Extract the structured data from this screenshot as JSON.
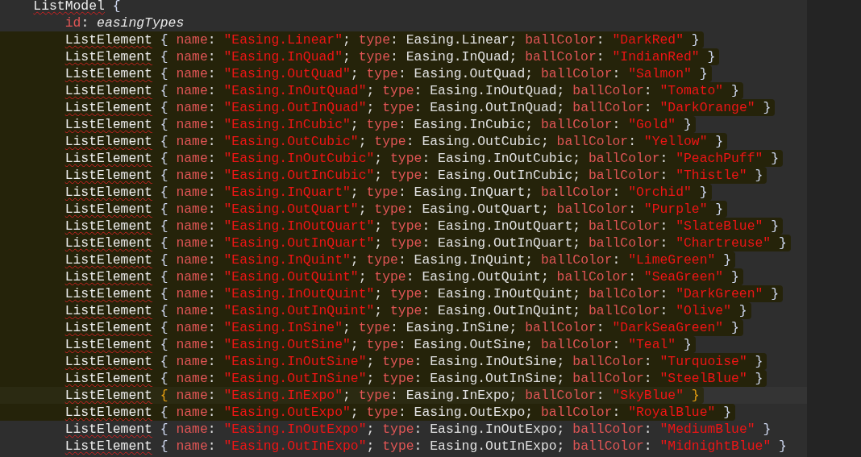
{
  "editor": {
    "lines": [
      {
        "selected": false,
        "current": false,
        "tokens": [
          {
            "kind": "type",
            "text": "ListModel"
          },
          {
            "kind": "brace",
            "text": " {",
            "matched": false
          }
        ],
        "children": [
          {
            "selected": false,
            "current": false,
            "tokens": [
              {
                "kind": "prop",
                "text": "id"
              },
              {
                "kind": "punct",
                "text": ": "
              },
              {
                "kind": "italic",
                "text": "easingTypes"
              }
            ]
          },
          {
            "selected": true,
            "current": false,
            "tokens": [
              {
                "kind": "type",
                "text": "ListElement"
              },
              {
                "kind": "brace",
                "text": " { ",
                "matched": false
              },
              {
                "kind": "prop",
                "text": "name"
              },
              {
                "kind": "punct",
                "text": ": "
              },
              {
                "kind": "str",
                "text": "\"Easing.Linear\""
              },
              {
                "kind": "punct",
                "text": "; "
              },
              {
                "kind": "prop",
                "text": "type"
              },
              {
                "kind": "punct",
                "text": ": Easing.Linear; "
              },
              {
                "kind": "prop",
                "text": "ballColor"
              },
              {
                "kind": "punct",
                "text": ": "
              },
              {
                "kind": "str",
                "text": "\"DarkRed\""
              },
              {
                "kind": "brace",
                "text": " }",
                "matched": false
              }
            ]
          },
          {
            "selected": true,
            "current": false,
            "tokens": [
              {
                "kind": "type",
                "text": "ListElement"
              },
              {
                "kind": "brace",
                "text": " { ",
                "matched": false
              },
              {
                "kind": "prop",
                "text": "name"
              },
              {
                "kind": "punct",
                "text": ": "
              },
              {
                "kind": "str",
                "text": "\"Easing.InQuad\""
              },
              {
                "kind": "punct",
                "text": "; "
              },
              {
                "kind": "prop",
                "text": "type"
              },
              {
                "kind": "punct",
                "text": ": Easing.InQuad; "
              },
              {
                "kind": "prop",
                "text": "ballColor"
              },
              {
                "kind": "punct",
                "text": ": "
              },
              {
                "kind": "str",
                "text": "\"IndianRed\""
              },
              {
                "kind": "brace",
                "text": " }",
                "matched": false
              }
            ]
          },
          {
            "selected": true,
            "current": false,
            "tokens": [
              {
                "kind": "type",
                "text": "ListElement"
              },
              {
                "kind": "brace",
                "text": " { ",
                "matched": false
              },
              {
                "kind": "prop",
                "text": "name"
              },
              {
                "kind": "punct",
                "text": ": "
              },
              {
                "kind": "str",
                "text": "\"Easing.OutQuad\""
              },
              {
                "kind": "punct",
                "text": "; "
              },
              {
                "kind": "prop",
                "text": "type"
              },
              {
                "kind": "punct",
                "text": ": Easing.OutQuad; "
              },
              {
                "kind": "prop",
                "text": "ballColor"
              },
              {
                "kind": "punct",
                "text": ": "
              },
              {
                "kind": "str",
                "text": "\"Salmon\""
              },
              {
                "kind": "brace",
                "text": " }",
                "matched": false
              }
            ]
          },
          {
            "selected": true,
            "current": false,
            "tokens": [
              {
                "kind": "type",
                "text": "ListElement"
              },
              {
                "kind": "brace",
                "text": " { ",
                "matched": false
              },
              {
                "kind": "prop",
                "text": "name"
              },
              {
                "kind": "punct",
                "text": ": "
              },
              {
                "kind": "str",
                "text": "\"Easing.InOutQuad\""
              },
              {
                "kind": "punct",
                "text": "; "
              },
              {
                "kind": "prop",
                "text": "type"
              },
              {
                "kind": "punct",
                "text": ": Easing.InOutQuad; "
              },
              {
                "kind": "prop",
                "text": "ballColor"
              },
              {
                "kind": "punct",
                "text": ": "
              },
              {
                "kind": "str",
                "text": "\"Tomato\""
              },
              {
                "kind": "brace",
                "text": " }",
                "matched": false
              }
            ]
          },
          {
            "selected": true,
            "current": false,
            "tokens": [
              {
                "kind": "type",
                "text": "ListElement"
              },
              {
                "kind": "brace",
                "text": " { ",
                "matched": false
              },
              {
                "kind": "prop",
                "text": "name"
              },
              {
                "kind": "punct",
                "text": ": "
              },
              {
                "kind": "str",
                "text": "\"Easing.OutInQuad\""
              },
              {
                "kind": "punct",
                "text": "; "
              },
              {
                "kind": "prop",
                "text": "type"
              },
              {
                "kind": "punct",
                "text": ": Easing.OutInQuad; "
              },
              {
                "kind": "prop",
                "text": "ballColor"
              },
              {
                "kind": "punct",
                "text": ": "
              },
              {
                "kind": "str",
                "text": "\"DarkOrange\""
              },
              {
                "kind": "brace",
                "text": " }",
                "matched": false
              }
            ]
          },
          {
            "selected": true,
            "current": false,
            "tokens": [
              {
                "kind": "type",
                "text": "ListElement"
              },
              {
                "kind": "brace",
                "text": " { ",
                "matched": false
              },
              {
                "kind": "prop",
                "text": "name"
              },
              {
                "kind": "punct",
                "text": ": "
              },
              {
                "kind": "str",
                "text": "\"Easing.InCubic\""
              },
              {
                "kind": "punct",
                "text": "; "
              },
              {
                "kind": "prop",
                "text": "type"
              },
              {
                "kind": "punct",
                "text": ": Easing.InCubic; "
              },
              {
                "kind": "prop",
                "text": "ballColor"
              },
              {
                "kind": "punct",
                "text": ": "
              },
              {
                "kind": "str",
                "text": "\"Gold\""
              },
              {
                "kind": "brace",
                "text": " }",
                "matched": false
              }
            ]
          },
          {
            "selected": true,
            "current": false,
            "tokens": [
              {
                "kind": "type",
                "text": "ListElement"
              },
              {
                "kind": "brace",
                "text": " { ",
                "matched": false
              },
              {
                "kind": "prop",
                "text": "name"
              },
              {
                "kind": "punct",
                "text": ": "
              },
              {
                "kind": "str",
                "text": "\"Easing.OutCubic\""
              },
              {
                "kind": "punct",
                "text": "; "
              },
              {
                "kind": "prop",
                "text": "type"
              },
              {
                "kind": "punct",
                "text": ": Easing.OutCubic; "
              },
              {
                "kind": "prop",
                "text": "ballColor"
              },
              {
                "kind": "punct",
                "text": ": "
              },
              {
                "kind": "str",
                "text": "\"Yellow\""
              },
              {
                "kind": "brace",
                "text": " }",
                "matched": false
              }
            ]
          },
          {
            "selected": true,
            "current": false,
            "tokens": [
              {
                "kind": "type",
                "text": "ListElement"
              },
              {
                "kind": "brace",
                "text": " { ",
                "matched": false
              },
              {
                "kind": "prop",
                "text": "name"
              },
              {
                "kind": "punct",
                "text": ": "
              },
              {
                "kind": "str",
                "text": "\"Easing.InOutCubic\""
              },
              {
                "kind": "punct",
                "text": "; "
              },
              {
                "kind": "prop",
                "text": "type"
              },
              {
                "kind": "punct",
                "text": ": Easing.InOutCubic; "
              },
              {
                "kind": "prop",
                "text": "ballColor"
              },
              {
                "kind": "punct",
                "text": ": "
              },
              {
                "kind": "str",
                "text": "\"PeachPuff\""
              },
              {
                "kind": "brace",
                "text": " }",
                "matched": false
              }
            ]
          },
          {
            "selected": true,
            "current": false,
            "tokens": [
              {
                "kind": "type",
                "text": "ListElement"
              },
              {
                "kind": "brace",
                "text": " { ",
                "matched": false
              },
              {
                "kind": "prop",
                "text": "name"
              },
              {
                "kind": "punct",
                "text": ": "
              },
              {
                "kind": "str",
                "text": "\"Easing.OutInCubic\""
              },
              {
                "kind": "punct",
                "text": "; "
              },
              {
                "kind": "prop",
                "text": "type"
              },
              {
                "kind": "punct",
                "text": ": Easing.OutInCubic; "
              },
              {
                "kind": "prop",
                "text": "ballColor"
              },
              {
                "kind": "punct",
                "text": ": "
              },
              {
                "kind": "str",
                "text": "\"Thistle\""
              },
              {
                "kind": "brace",
                "text": " }",
                "matched": false
              }
            ]
          },
          {
            "selected": true,
            "current": false,
            "tokens": [
              {
                "kind": "type",
                "text": "ListElement"
              },
              {
                "kind": "brace",
                "text": " { ",
                "matched": false
              },
              {
                "kind": "prop",
                "text": "name"
              },
              {
                "kind": "punct",
                "text": ": "
              },
              {
                "kind": "str",
                "text": "\"Easing.InQuart\""
              },
              {
                "kind": "punct",
                "text": "; "
              },
              {
                "kind": "prop",
                "text": "type"
              },
              {
                "kind": "punct",
                "text": ": Easing.InQuart; "
              },
              {
                "kind": "prop",
                "text": "ballColor"
              },
              {
                "kind": "punct",
                "text": ": "
              },
              {
                "kind": "str",
                "text": "\"Orchid\""
              },
              {
                "kind": "brace",
                "text": " }",
                "matched": false
              }
            ]
          },
          {
            "selected": true,
            "current": false,
            "tokens": [
              {
                "kind": "type",
                "text": "ListElement"
              },
              {
                "kind": "brace",
                "text": " { ",
                "matched": false
              },
              {
                "kind": "prop",
                "text": "name"
              },
              {
                "kind": "punct",
                "text": ": "
              },
              {
                "kind": "str",
                "text": "\"Easing.OutQuart\""
              },
              {
                "kind": "punct",
                "text": "; "
              },
              {
                "kind": "prop",
                "text": "type"
              },
              {
                "kind": "punct",
                "text": ": Easing.OutQuart; "
              },
              {
                "kind": "prop",
                "text": "ballColor"
              },
              {
                "kind": "punct",
                "text": ": "
              },
              {
                "kind": "str",
                "text": "\"Purple\""
              },
              {
                "kind": "brace",
                "text": " }",
                "matched": false
              }
            ]
          },
          {
            "selected": true,
            "current": false,
            "tokens": [
              {
                "kind": "type",
                "text": "ListElement"
              },
              {
                "kind": "brace",
                "text": " { ",
                "matched": false
              },
              {
                "kind": "prop",
                "text": "name"
              },
              {
                "kind": "punct",
                "text": ": "
              },
              {
                "kind": "str",
                "text": "\"Easing.InOutQuart\""
              },
              {
                "kind": "punct",
                "text": "; "
              },
              {
                "kind": "prop",
                "text": "type"
              },
              {
                "kind": "punct",
                "text": ": Easing.InOutQuart; "
              },
              {
                "kind": "prop",
                "text": "ballColor"
              },
              {
                "kind": "punct",
                "text": ": "
              },
              {
                "kind": "str",
                "text": "\"SlateBlue\""
              },
              {
                "kind": "brace",
                "text": " }",
                "matched": false
              }
            ]
          },
          {
            "selected": true,
            "current": false,
            "tokens": [
              {
                "kind": "type",
                "text": "ListElement"
              },
              {
                "kind": "brace",
                "text": " { ",
                "matched": false
              },
              {
                "kind": "prop",
                "text": "name"
              },
              {
                "kind": "punct",
                "text": ": "
              },
              {
                "kind": "str",
                "text": "\"Easing.OutInQuart\""
              },
              {
                "kind": "punct",
                "text": "; "
              },
              {
                "kind": "prop",
                "text": "type"
              },
              {
                "kind": "punct",
                "text": ": Easing.OutInQuart; "
              },
              {
                "kind": "prop",
                "text": "ballColor"
              },
              {
                "kind": "punct",
                "text": ": "
              },
              {
                "kind": "str",
                "text": "\"Chartreuse\""
              },
              {
                "kind": "brace",
                "text": " }",
                "matched": false
              }
            ]
          },
          {
            "selected": true,
            "current": false,
            "tokens": [
              {
                "kind": "type",
                "text": "ListElement"
              },
              {
                "kind": "brace",
                "text": " { ",
                "matched": false
              },
              {
                "kind": "prop",
                "text": "name"
              },
              {
                "kind": "punct",
                "text": ": "
              },
              {
                "kind": "str",
                "text": "\"Easing.InQuint\""
              },
              {
                "kind": "punct",
                "text": "; "
              },
              {
                "kind": "prop",
                "text": "type"
              },
              {
                "kind": "punct",
                "text": ": Easing.InQuint; "
              },
              {
                "kind": "prop",
                "text": "ballColor"
              },
              {
                "kind": "punct",
                "text": ": "
              },
              {
                "kind": "str",
                "text": "\"LimeGreen\""
              },
              {
                "kind": "brace",
                "text": " }",
                "matched": false
              }
            ]
          },
          {
            "selected": true,
            "current": false,
            "tokens": [
              {
                "kind": "type",
                "text": "ListElement"
              },
              {
                "kind": "brace",
                "text": " { ",
                "matched": false
              },
              {
                "kind": "prop",
                "text": "name"
              },
              {
                "kind": "punct",
                "text": ": "
              },
              {
                "kind": "str",
                "text": "\"Easing.OutQuint\""
              },
              {
                "kind": "punct",
                "text": "; "
              },
              {
                "kind": "prop",
                "text": "type"
              },
              {
                "kind": "punct",
                "text": ": Easing.OutQuint; "
              },
              {
                "kind": "prop",
                "text": "ballColor"
              },
              {
                "kind": "punct",
                "text": ": "
              },
              {
                "kind": "str",
                "text": "\"SeaGreen\""
              },
              {
                "kind": "brace",
                "text": " }",
                "matched": false
              }
            ]
          },
          {
            "selected": true,
            "current": false,
            "tokens": [
              {
                "kind": "type",
                "text": "ListElement"
              },
              {
                "kind": "brace",
                "text": " { ",
                "matched": false
              },
              {
                "kind": "prop",
                "text": "name"
              },
              {
                "kind": "punct",
                "text": ": "
              },
              {
                "kind": "str",
                "text": "\"Easing.InOutQuint\""
              },
              {
                "kind": "punct",
                "text": "; "
              },
              {
                "kind": "prop",
                "text": "type"
              },
              {
                "kind": "punct",
                "text": ": Easing.InOutQuint; "
              },
              {
                "kind": "prop",
                "text": "ballColor"
              },
              {
                "kind": "punct",
                "text": ": "
              },
              {
                "kind": "str",
                "text": "\"DarkGreen\""
              },
              {
                "kind": "brace",
                "text": " }",
                "matched": false
              }
            ]
          },
          {
            "selected": true,
            "current": false,
            "tokens": [
              {
                "kind": "type",
                "text": "ListElement"
              },
              {
                "kind": "brace",
                "text": " { ",
                "matched": false
              },
              {
                "kind": "prop",
                "text": "name"
              },
              {
                "kind": "punct",
                "text": ": "
              },
              {
                "kind": "str",
                "text": "\"Easing.OutInQuint\""
              },
              {
                "kind": "punct",
                "text": "; "
              },
              {
                "kind": "prop",
                "text": "type"
              },
              {
                "kind": "punct",
                "text": ": Easing.OutInQuint; "
              },
              {
                "kind": "prop",
                "text": "ballColor"
              },
              {
                "kind": "punct",
                "text": ": "
              },
              {
                "kind": "str",
                "text": "\"Olive\""
              },
              {
                "kind": "brace",
                "text": " }",
                "matched": false
              }
            ]
          },
          {
            "selected": true,
            "current": false,
            "tokens": [
              {
                "kind": "type",
                "text": "ListElement"
              },
              {
                "kind": "brace",
                "text": " { ",
                "matched": false
              },
              {
                "kind": "prop",
                "text": "name"
              },
              {
                "kind": "punct",
                "text": ": "
              },
              {
                "kind": "str",
                "text": "\"Easing.InSine\""
              },
              {
                "kind": "punct",
                "text": "; "
              },
              {
                "kind": "prop",
                "text": "type"
              },
              {
                "kind": "punct",
                "text": ": Easing.InSine; "
              },
              {
                "kind": "prop",
                "text": "ballColor"
              },
              {
                "kind": "punct",
                "text": ": "
              },
              {
                "kind": "str",
                "text": "\"DarkSeaGreen\""
              },
              {
                "kind": "brace",
                "text": " }",
                "matched": false
              }
            ]
          },
          {
            "selected": true,
            "current": false,
            "tokens": [
              {
                "kind": "type",
                "text": "ListElement"
              },
              {
                "kind": "brace",
                "text": " { ",
                "matched": false
              },
              {
                "kind": "prop",
                "text": "name"
              },
              {
                "kind": "punct",
                "text": ": "
              },
              {
                "kind": "str",
                "text": "\"Easing.OutSine\""
              },
              {
                "kind": "punct",
                "text": "; "
              },
              {
                "kind": "prop",
                "text": "type"
              },
              {
                "kind": "punct",
                "text": ": Easing.OutSine; "
              },
              {
                "kind": "prop",
                "text": "ballColor"
              },
              {
                "kind": "punct",
                "text": ": "
              },
              {
                "kind": "str",
                "text": "\"Teal\""
              },
              {
                "kind": "brace",
                "text": " }",
                "matched": false
              }
            ]
          },
          {
            "selected": true,
            "current": false,
            "tokens": [
              {
                "kind": "type",
                "text": "ListElement"
              },
              {
                "kind": "brace",
                "text": " { ",
                "matched": false
              },
              {
                "kind": "prop",
                "text": "name"
              },
              {
                "kind": "punct",
                "text": ": "
              },
              {
                "kind": "str",
                "text": "\"Easing.InOutSine\""
              },
              {
                "kind": "punct",
                "text": "; "
              },
              {
                "kind": "prop",
                "text": "type"
              },
              {
                "kind": "punct",
                "text": ": Easing.InOutSine; "
              },
              {
                "kind": "prop",
                "text": "ballColor"
              },
              {
                "kind": "punct",
                "text": ": "
              },
              {
                "kind": "str",
                "text": "\"Turquoise\""
              },
              {
                "kind": "brace",
                "text": " }",
                "matched": false
              }
            ]
          },
          {
            "selected": true,
            "current": false,
            "tokens": [
              {
                "kind": "type",
                "text": "ListElement"
              },
              {
                "kind": "brace",
                "text": " { ",
                "matched": false
              },
              {
                "kind": "prop",
                "text": "name"
              },
              {
                "kind": "punct",
                "text": ": "
              },
              {
                "kind": "str",
                "text": "\"Easing.OutInSine\""
              },
              {
                "kind": "punct",
                "text": "; "
              },
              {
                "kind": "prop",
                "text": "type"
              },
              {
                "kind": "punct",
                "text": ": Easing.OutInSine; "
              },
              {
                "kind": "prop",
                "text": "ballColor"
              },
              {
                "kind": "punct",
                "text": ": "
              },
              {
                "kind": "str",
                "text": "\"SteelBlue\""
              },
              {
                "kind": "brace",
                "text": " }",
                "matched": false
              }
            ]
          },
          {
            "selected": true,
            "current": true,
            "tokens": [
              {
                "kind": "type",
                "text": "ListElement"
              },
              {
                "kind": "brace",
                "text": " { ",
                "matched": true
              },
              {
                "kind": "prop",
                "text": "name"
              },
              {
                "kind": "punct",
                "text": ": "
              },
              {
                "kind": "str",
                "text": "\"Easing.InExpo\""
              },
              {
                "kind": "punct",
                "text": "; "
              },
              {
                "kind": "prop",
                "text": "type"
              },
              {
                "kind": "punct",
                "text": ": Easing.InExpo; "
              },
              {
                "kind": "prop",
                "text": "ballColor"
              },
              {
                "kind": "punct",
                "text": ": "
              },
              {
                "kind": "str",
                "text": "\"SkyBlue\""
              },
              {
                "kind": "brace",
                "text": " }",
                "matched": true
              }
            ]
          },
          {
            "selected": true,
            "current": false,
            "tokens": [
              {
                "kind": "type",
                "text": "ListElement"
              },
              {
                "kind": "brace",
                "text": " { ",
                "matched": false
              },
              {
                "kind": "prop",
                "text": "name"
              },
              {
                "kind": "punct",
                "text": ": "
              },
              {
                "kind": "str",
                "text": "\"Easing.OutExpo\""
              },
              {
                "kind": "punct",
                "text": "; "
              },
              {
                "kind": "prop",
                "text": "type"
              },
              {
                "kind": "punct",
                "text": ": Easing.OutExpo; "
              },
              {
                "kind": "prop",
                "text": "ballColor"
              },
              {
                "kind": "punct",
                "text": ": "
              },
              {
                "kind": "str",
                "text": "\"RoyalBlue\""
              },
              {
                "kind": "brace",
                "text": " }",
                "matched": false
              }
            ]
          },
          {
            "selected": false,
            "current": false,
            "tokens": [
              {
                "kind": "type",
                "text": "ListElement"
              },
              {
                "kind": "brace",
                "text": " { ",
                "matched": false
              },
              {
                "kind": "prop",
                "text": "name"
              },
              {
                "kind": "punct",
                "text": ": "
              },
              {
                "kind": "str",
                "text": "\"Easing.InOutExpo\""
              },
              {
                "kind": "punct",
                "text": "; "
              },
              {
                "kind": "prop",
                "text": "type"
              },
              {
                "kind": "punct",
                "text": ": Easing.InOutExpo; "
              },
              {
                "kind": "prop",
                "text": "ballColor"
              },
              {
                "kind": "punct",
                "text": ": "
              },
              {
                "kind": "str",
                "text": "\"MediumBlue\""
              },
              {
                "kind": "brace",
                "text": " }",
                "matched": false
              }
            ]
          },
          {
            "selected": false,
            "current": false,
            "tokens": [
              {
                "kind": "type",
                "text": "ListElement"
              },
              {
                "kind": "brace",
                "text": " { ",
                "matched": false
              },
              {
                "kind": "prop",
                "text": "name"
              },
              {
                "kind": "punct",
                "text": ": "
              },
              {
                "kind": "str",
                "text": "\"Easing.OutInExpo\""
              },
              {
                "kind": "punct",
                "text": "; "
              },
              {
                "kind": "prop",
                "text": "type"
              },
              {
                "kind": "punct",
                "text": ": Easing.OutInExpo; "
              },
              {
                "kind": "prop",
                "text": "ballColor"
              },
              {
                "kind": "punct",
                "text": ": "
              },
              {
                "kind": "str",
                "text": "\"MidnightBlue\""
              },
              {
                "kind": "brace",
                "text": " }",
                "matched": false
              }
            ]
          }
        ]
      }
    ]
  }
}
